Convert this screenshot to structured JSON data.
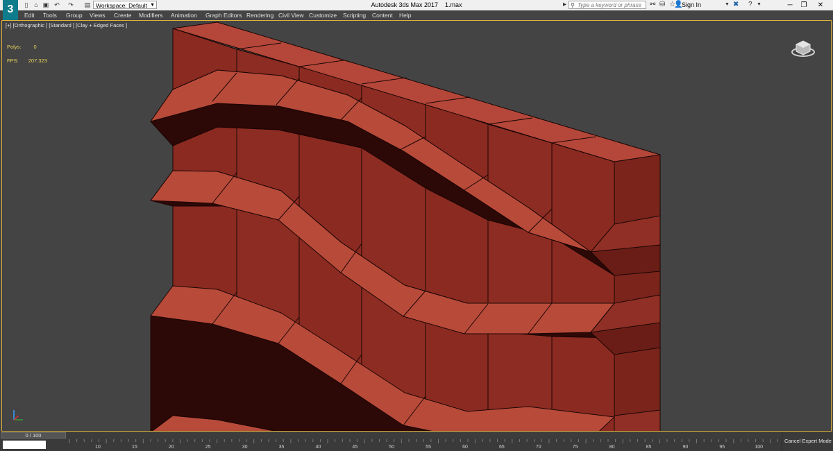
{
  "app": {
    "title": "Autodesk 3ds Max 2017",
    "file": "1.max",
    "icon_label": "3"
  },
  "quick_access": {
    "workspace_label": "Workspace: Default",
    "icons": [
      "new-icon",
      "open-icon",
      "save-icon",
      "undo-icon",
      "redo-icon",
      "project-icon"
    ]
  },
  "search": {
    "placeholder": "Type a keyword or phrase"
  },
  "account": {
    "signin_label": "Sign In"
  },
  "menu": [
    "Edit",
    "Tools",
    "Group",
    "Views",
    "Create",
    "Modifiers",
    "Animation",
    "Graph Editors",
    "Rendering",
    "Civil View",
    "Customize",
    "Scripting",
    "Content",
    "Help"
  ],
  "viewport": {
    "label": "[+] [Orthographic ] [Standard ] [Clay + Edged Faces ]",
    "stats": {
      "polys_label": "Polys:",
      "polys_value": "0",
      "fps_label": "FPS:",
      "fps_value": "207.323"
    },
    "colors": {
      "background": "#444444",
      "border": "#e0b33c",
      "mesh_face": "#8b2b22",
      "mesh_top": "#b94a3c",
      "mesh_shadow": "#2a0806"
    }
  },
  "timeline": {
    "frame_display": "0 / 100",
    "ticks": [
      "10",
      "15",
      "20",
      "25",
      "30",
      "35",
      "40",
      "45",
      "50",
      "55",
      "60",
      "65",
      "70",
      "75",
      "80",
      "85",
      "90",
      "95",
      "100"
    ],
    "cancel_label": "Cancel Expert Mode"
  }
}
